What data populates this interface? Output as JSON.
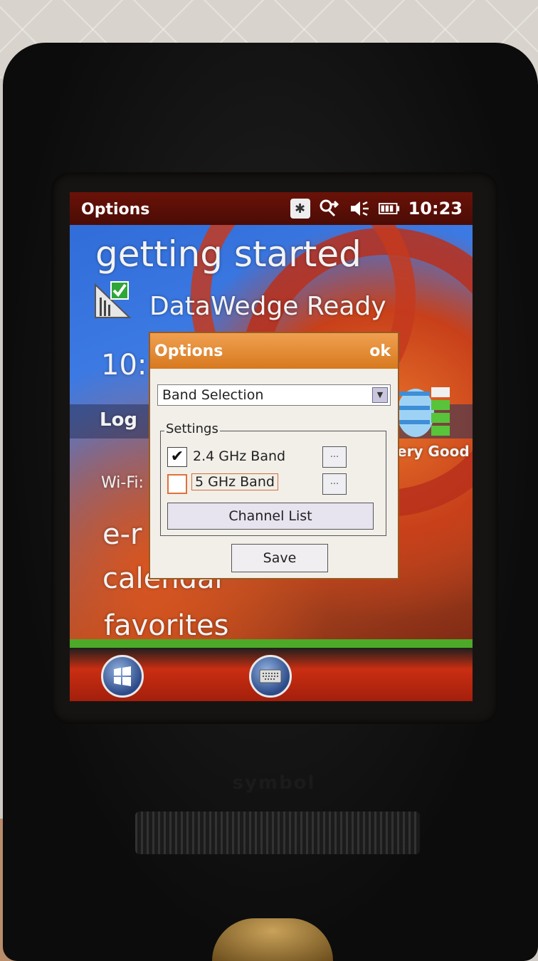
{
  "status_bar": {
    "title": "Options",
    "time": "10:23"
  },
  "home": {
    "getting_started": "getting started",
    "datawedge": "DataWedge Ready",
    "time_partial": "10:",
    "log_partial": "Log",
    "wifi_partial": "Wi-Fi:",
    "signal_partial": "ery Good",
    "email_partial": "e-r",
    "calendar": "calendar",
    "favorites": "favorites"
  },
  "dialog": {
    "title": "Options",
    "ok_label": "ok",
    "dropdown_value": "Band Selection",
    "group_label": "Settings",
    "band_24_label": "2.4 GHz Band",
    "band_24_checked": true,
    "band_5_label": "5 GHz Band",
    "band_5_checked": false,
    "ellipsis_label": "...",
    "channel_list_label": "Channel List",
    "save_label": "Save"
  },
  "device": {
    "brand": "symbol"
  },
  "colors": {
    "title_bar": "#5a0f06",
    "dialog_title": "#e08a2e",
    "dialog_body": "#f1efe8",
    "focus_border": "#e0703a"
  }
}
